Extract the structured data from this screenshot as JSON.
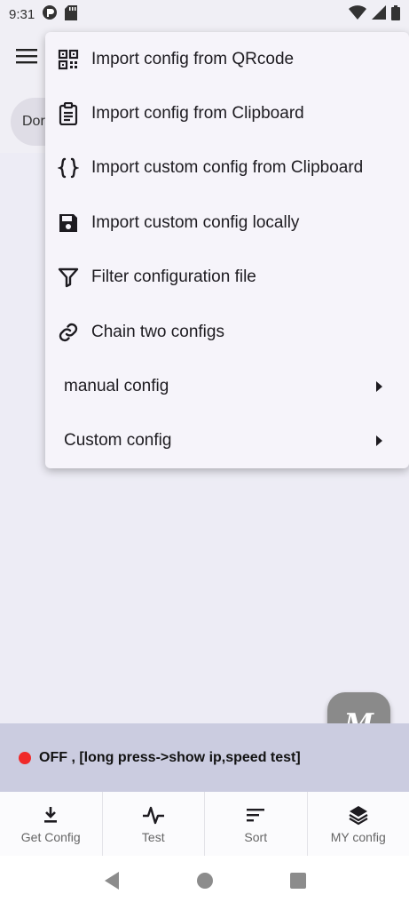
{
  "status_bar": {
    "time": "9:31"
  },
  "chip": {
    "label": "Dor"
  },
  "menu": {
    "items": [
      {
        "label": "Import config from QRcode",
        "icon": "qrcode-icon"
      },
      {
        "label": "Import config from Clipboard",
        "icon": "clipboard-icon"
      },
      {
        "label": "Import custom config from Clipboard",
        "icon": "braces-icon"
      },
      {
        "label": "Import custom config locally",
        "icon": "save-icon"
      },
      {
        "label": "Filter configuration file",
        "icon": "filter-icon"
      },
      {
        "label": "Chain two configs",
        "icon": "link-icon"
      }
    ],
    "submenus": [
      {
        "label": "manual config"
      },
      {
        "label": "Custom config"
      }
    ]
  },
  "fab": {
    "label": "M"
  },
  "connection": {
    "status_text": "OFF , [long press->show ip,speed test]",
    "status_color": "#f02a2a"
  },
  "tabs": [
    {
      "label": "Get Config",
      "icon": "download-icon"
    },
    {
      "label": "Test",
      "icon": "pulse-icon"
    },
    {
      "label": "Sort",
      "icon": "sort-icon"
    },
    {
      "label": "MY config",
      "icon": "layers-icon"
    }
  ]
}
